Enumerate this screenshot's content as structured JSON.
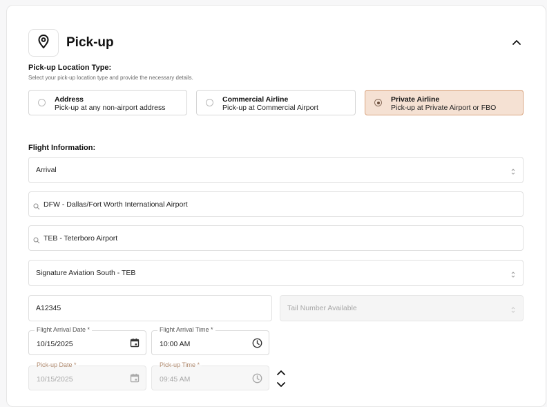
{
  "section": {
    "title": "Pick-up",
    "icon": "map-pin-icon",
    "collapse_icon": "chevron-up-icon"
  },
  "location_type": {
    "label": "Pick-up Location Type:",
    "help": "Select your pick-up location type and provide the necessary details.",
    "options": [
      {
        "title": "Address",
        "subtitle": "Pick-up at any non-airport address",
        "selected": false
      },
      {
        "title": "Commercial Airline",
        "subtitle": "Pick-up at Commercial Airport",
        "selected": false
      },
      {
        "title": "Private Airline",
        "subtitle": "Pick-up at Private Airport or FBO",
        "selected": true
      }
    ]
  },
  "flight": {
    "label": "Flight Information:",
    "direction": "Arrival",
    "origin_airport": "DFW - Dallas/Fort Worth International Airport",
    "destination_airport": "TEB - Teterboro Airport",
    "fbo": "Signature Aviation South - TEB",
    "tail_number_value": "A12345",
    "tail_number_select": "Tail Number Available",
    "arrival_date_label": "Flight Arrival Date *",
    "arrival_date": "10/15/2025",
    "arrival_time_label": "Flight Arrival Time *",
    "arrival_time": "10:00 AM",
    "pickup_date_label": "Pick-up Date *",
    "pickup_date": "10/15/2025",
    "pickup_time_label": "Pick-up Time *",
    "pickup_time": "09:45 AM"
  },
  "colors": {
    "selected_bg": "#f5e1d3",
    "selected_border": "#d9a47f",
    "disabled_label": "#b08a6e"
  }
}
